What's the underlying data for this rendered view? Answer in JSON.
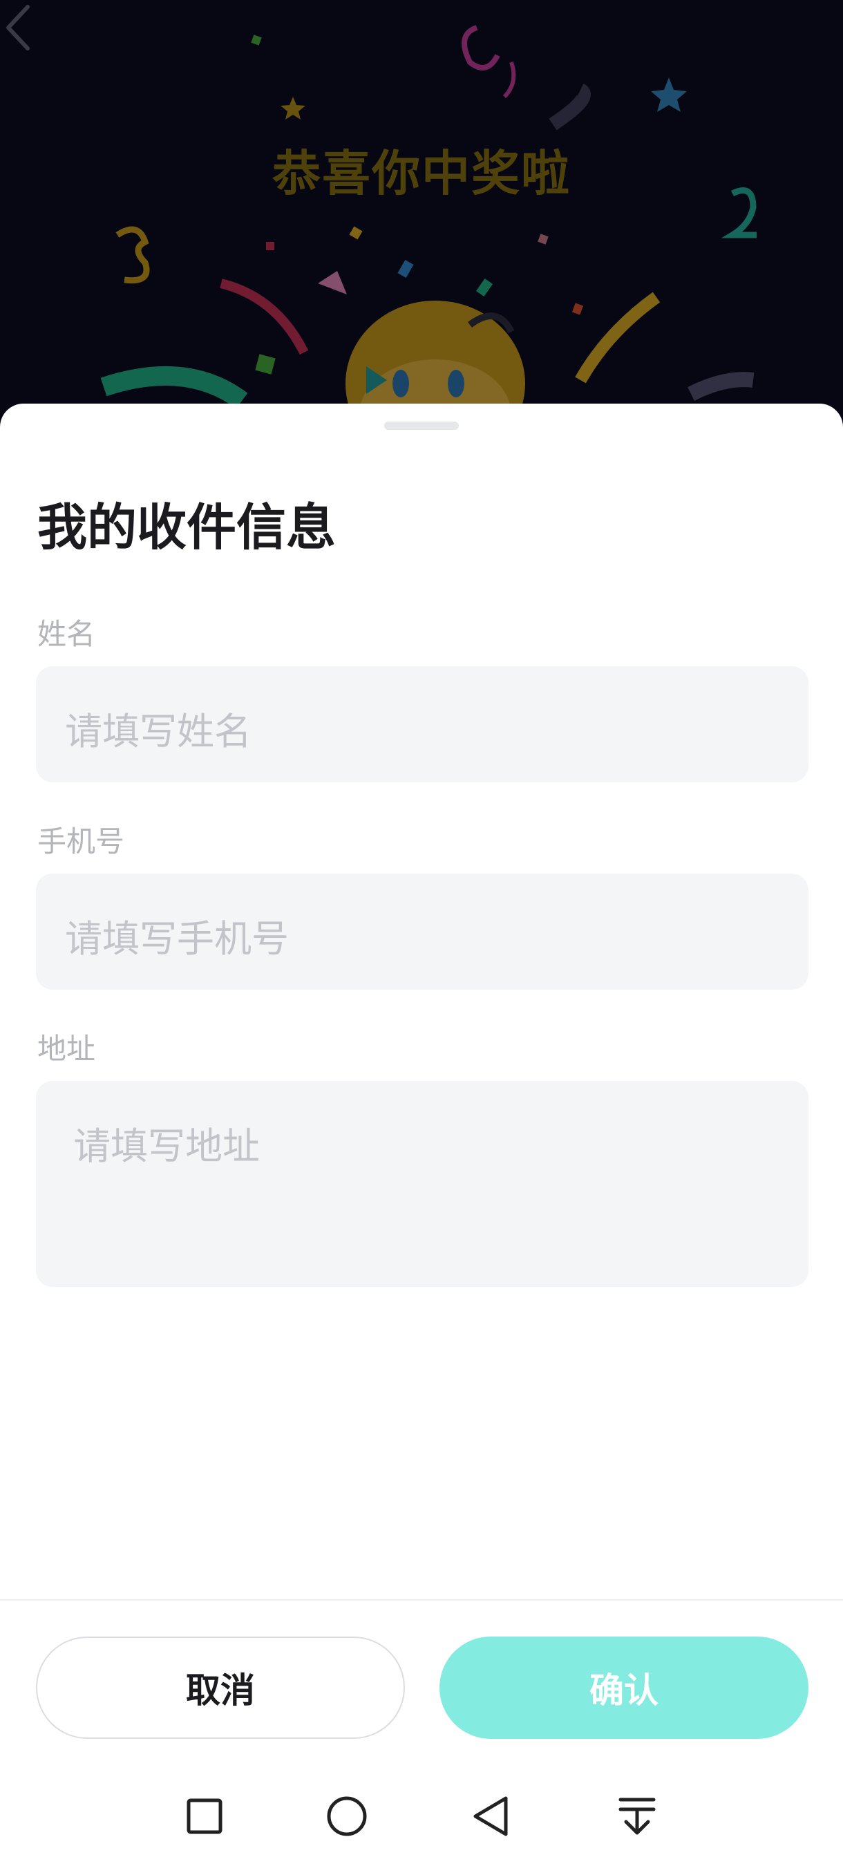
{
  "hero": {
    "title": "恭喜你中奖啦"
  },
  "sheet": {
    "title": "我的收件信息",
    "fields": [
      {
        "label": "姓名",
        "placeholder": "请填写姓名",
        "value": ""
      },
      {
        "label": "手机号",
        "placeholder": "请填写手机号",
        "value": ""
      },
      {
        "label": "地址",
        "placeholder": "请填写地址",
        "value": ""
      }
    ],
    "cancel_label": "取消",
    "confirm_label": "确认"
  },
  "colors": {
    "accent": "#84ebe0",
    "title_gold": "#7a6410",
    "background": "#0b0a1e"
  },
  "icons": {
    "back": "chevron-left-icon",
    "recent_apps": "square-icon",
    "home": "circle-icon",
    "nav_back": "triangle-back-icon",
    "notification": "pull-down-icon"
  }
}
